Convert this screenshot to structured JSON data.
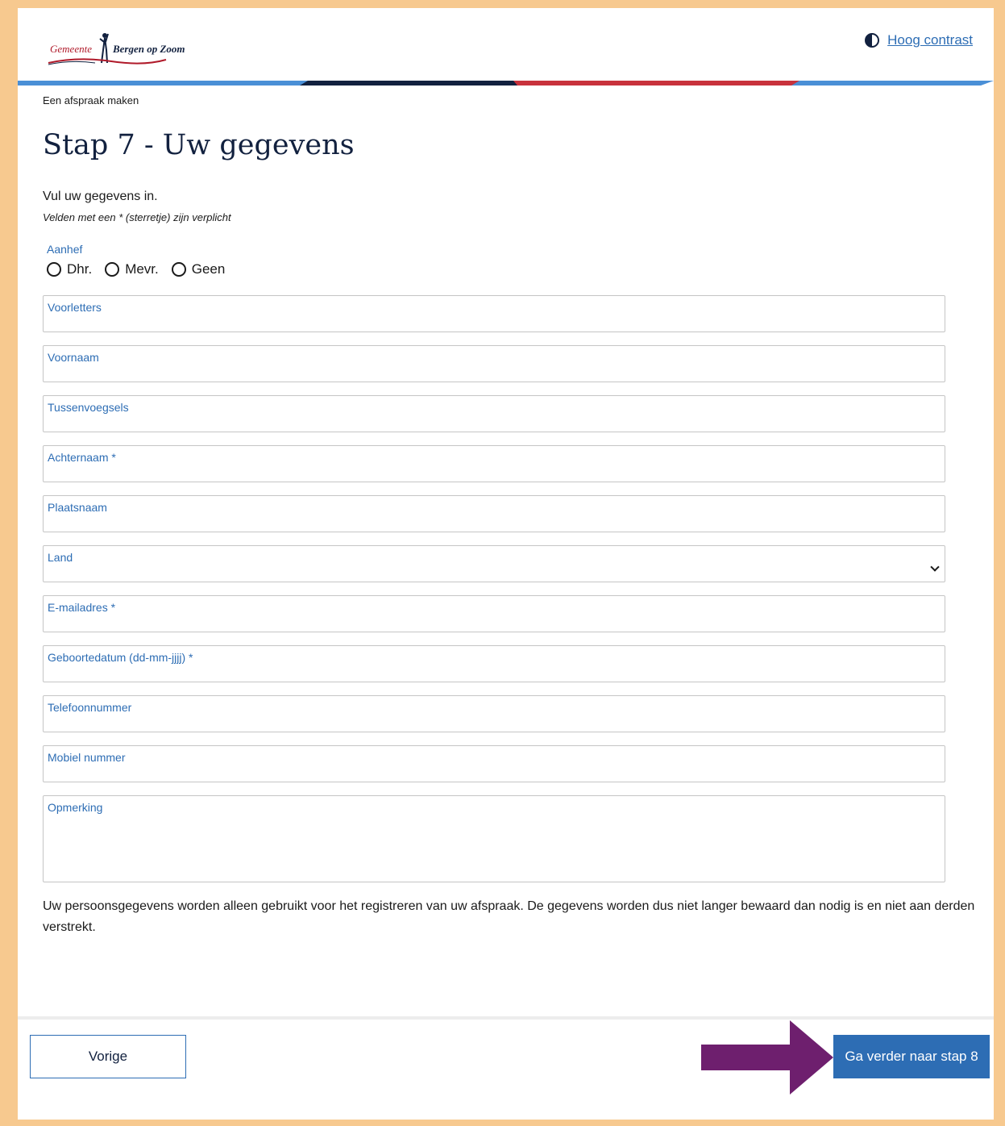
{
  "header": {
    "logo_gemeente": "Gemeente",
    "logo_city": "Bergen op Zoom",
    "contrast_label": "Hoog contrast"
  },
  "breadcrumb": "Een afspraak maken",
  "page_title": "Stap 7 - Uw gegevens",
  "intro": "Vul uw gegevens in.",
  "required_note": "Velden met een * (sterretje) zijn verplicht",
  "aanhef": {
    "label": "Aanhef",
    "options": [
      "Dhr.",
      "Mevr.",
      "Geen"
    ]
  },
  "fields": {
    "voorletters": "Voorletters",
    "voornaam": "Voornaam",
    "tussenvoegsels": "Tussenvoegsels",
    "achternaam": "Achternaam *",
    "plaatsnaam": "Plaatsnaam",
    "land": "Land",
    "email": "E-mailadres *",
    "geboortedatum": "Geboortedatum (dd-mm-jjjj) *",
    "telefoon": "Telefoonnummer",
    "mobiel": "Mobiel nummer",
    "opmerking": "Opmerking"
  },
  "privacy_text": "Uw persoonsgegevens worden alleen gebruikt voor het registreren van uw afspraak. De gegevens worden dus niet langer bewaard dan nodig is en niet aan derden verstrekt.",
  "buttons": {
    "previous": "Vorige",
    "next": "Ga verder naar stap 8"
  },
  "colors": {
    "accent": "#2d6db4",
    "frame": "#f7c98f",
    "navy": "#12213f",
    "annotation_arrow": "#6e1f6e"
  }
}
